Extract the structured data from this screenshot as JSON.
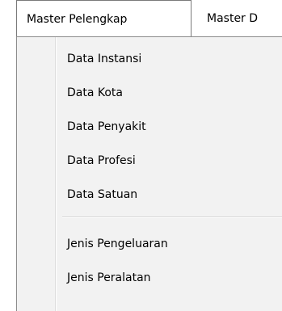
{
  "menubar": {
    "items": [
      {
        "label": "Master Pelengkap"
      },
      {
        "label": "Master D"
      }
    ]
  },
  "dropdown": {
    "group1": [
      {
        "label": "Data Instansi"
      },
      {
        "label": "Data Kota"
      },
      {
        "label": "Data Penyakit"
      },
      {
        "label": "Data Profesi"
      },
      {
        "label": "Data Satuan"
      }
    ],
    "group2": [
      {
        "label": "Jenis Pengeluaran"
      },
      {
        "label": "Jenis Peralatan"
      }
    ]
  }
}
